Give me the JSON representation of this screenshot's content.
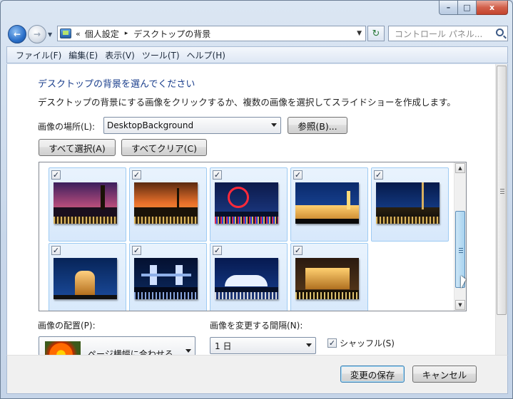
{
  "window": {
    "caption_buttons": {
      "minimize": "–",
      "maximize": "□",
      "close": "x"
    }
  },
  "navigation": {
    "back_icon": "back-arrow-icon",
    "forward_icon": "forward-arrow-icon",
    "address": {
      "prefix": "«",
      "crumb1": "個人設定",
      "arrow": "▸",
      "crumb2": "デスクトップの背景"
    },
    "search_placeholder": "コントロール パネル..."
  },
  "menubar": [
    "ファイル(F)",
    "編集(E)",
    "表示(V)",
    "ツール(T)",
    "ヘルプ(H)"
  ],
  "main": {
    "title": "デスクトップの背景を選んでください",
    "description": "デスクトップの背景にする画像をクリックするか、複数の画像を選択してスライドショーを作成します。",
    "location_label": "画像の場所(L):",
    "location_value": "DesktopBackground",
    "browse_button": "参照(B)...",
    "select_all_button": "すべて選択(A)",
    "clear_all_button": "すべてクリア(C)",
    "check_mark": "✓",
    "images_count": 9,
    "position_label": "画像の配置(P):",
    "position_value": "ページ横幅に合わせる",
    "interval_label": "画像を変更する間隔(N):",
    "interval_value": "1 日",
    "shuffle_label": "シャッフル(S)",
    "shuffle_checked": true
  },
  "footer": {
    "save_button": "変更の保存",
    "cancel_button": "キャンセル"
  },
  "colors": {
    "accent": "#1a3e8c",
    "tile_bg": "#d7e8fb",
    "tile_border": "#9ecbf3"
  }
}
